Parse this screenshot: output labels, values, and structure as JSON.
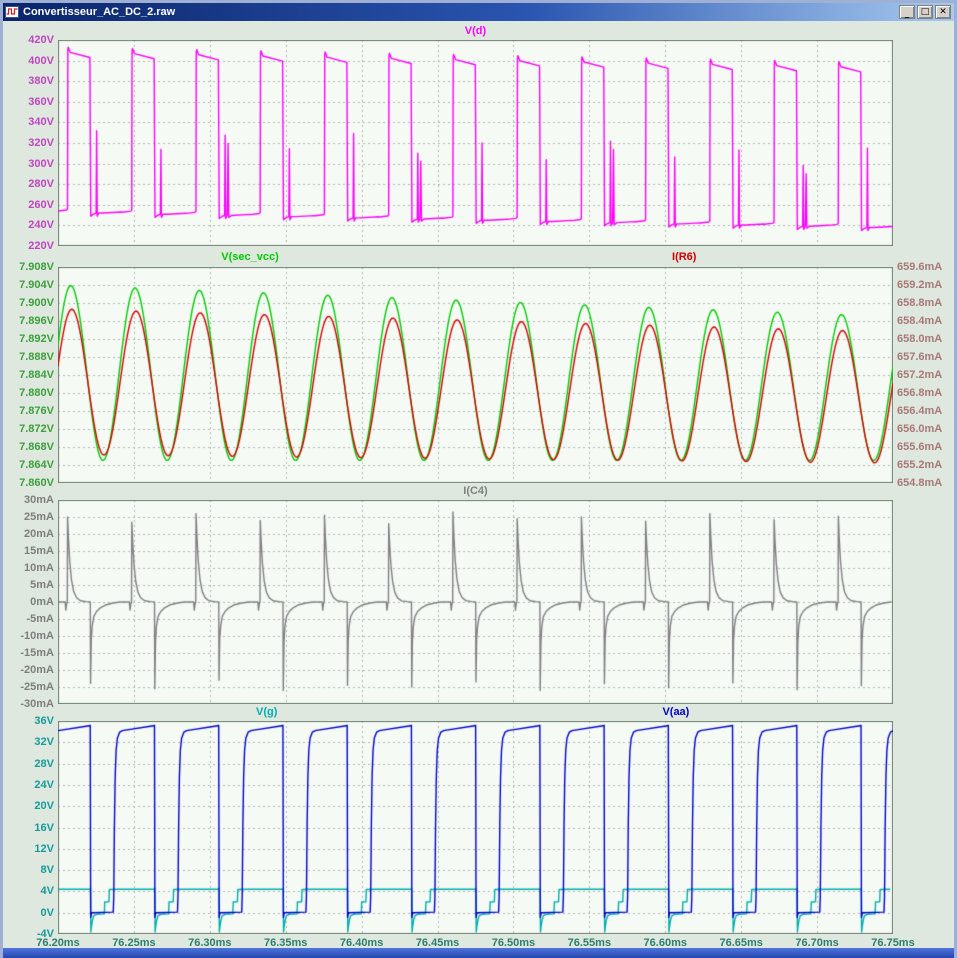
{
  "window": {
    "title": "Convertisseur_AC_DC_2.raw",
    "controls": {
      "minimize": "_",
      "maximize": "□",
      "close": "✕"
    }
  },
  "time_axis": {
    "unit": "ms",
    "start_ms": 76.2,
    "end_ms": 76.75,
    "tick_step_ms": 0.05,
    "tick_labels": [
      "76.20ms",
      "76.25ms",
      "76.30ms",
      "76.35ms",
      "76.40ms",
      "76.45ms",
      "76.50ms",
      "76.55ms",
      "76.60ms",
      "76.65ms",
      "76.70ms",
      "76.75ms"
    ],
    "label_color": "#2E7D6E"
  },
  "chart_data": [
    {
      "type": "line",
      "id": "vd",
      "traces": [
        {
          "name": "V(d)",
          "color": "#FF00FF",
          "axis": "left",
          "title_x_frac": 0.5,
          "waveform": {
            "kind": "switch_node",
            "cycles": 13,
            "high": 408,
            "low": 252,
            "drift": -14,
            "spikes": [
              332,
              315,
              330,
              318,
              334,
              316,
              327,
              312,
              331,
              317,
              325,
              311,
              329
            ]
          }
        }
      ],
      "y_axis_left": {
        "unit": "V",
        "min": 220,
        "max": 420,
        "step": 20,
        "color": "#BE46BE",
        "tick_labels": [
          "420V",
          "400V",
          "380V",
          "360V",
          "340V",
          "320V",
          "300V",
          "280V",
          "260V",
          "240V",
          "220V"
        ]
      }
    },
    {
      "type": "line",
      "id": "sec-vcc-ir6",
      "traces": [
        {
          "name": "V(sec_vcc)",
          "color": "#00CC00",
          "axis": "left",
          "title_x_frac": 0.23,
          "waveform": {
            "kind": "ripple",
            "cycles": 13,
            "mid": 7.8845,
            "amp": 0.0195,
            "mid_drift": -0.0035,
            "amp_decay": 0.18,
            "peak_frac": 0.2
          }
        },
        {
          "name": "I(R6)",
          "color": "#D40000",
          "axis": "right",
          "title_x_frac": 0.75,
          "waveform": {
            "kind": "ripple",
            "cycles": 13,
            "mid": 657.05,
            "amp": 1.62,
            "mid_drift": -0.35,
            "amp_decay": 0.1,
            "peak_frac": 0.215
          }
        }
      ],
      "y_axis_left": {
        "unit": "V",
        "min": 7.86,
        "max": 7.908,
        "step": 0.004,
        "color": "#3C9E3C",
        "tick_labels": [
          "7.908V",
          "7.904V",
          "7.900V",
          "7.896V",
          "7.892V",
          "7.888V",
          "7.884V",
          "7.880V",
          "7.876V",
          "7.872V",
          "7.868V",
          "7.864V",
          "7.860V"
        ]
      },
      "y_axis_right": {
        "unit": "mA",
        "min": 654.8,
        "max": 659.6,
        "step": 0.4,
        "color": "#A87878",
        "tick_labels": [
          "659.6mA",
          "659.2mA",
          "658.8mA",
          "658.4mA",
          "658.0mA",
          "657.6mA",
          "657.2mA",
          "656.8mA",
          "656.4mA",
          "656.0mA",
          "655.6mA",
          "655.2mA",
          "654.8mA"
        ]
      }
    },
    {
      "type": "line",
      "id": "ic4",
      "traces": [
        {
          "name": "I(C4)",
          "color": "#808080",
          "axis": "left",
          "title_x_frac": 0.5,
          "waveform": {
            "kind": "cap_current",
            "cycles": 13,
            "pos": [
              25,
              23.5,
              26,
              24,
              25.5,
              23,
              26.5,
              24.5,
              25,
              23.8,
              26,
              24.2,
              25.2
            ],
            "neg": [
              24,
              25.5,
              23,
              26,
              24.5,
              25,
              23.5,
              26,
              24,
              25.2,
              23.8,
              25.8,
              24.6
            ]
          }
        }
      ],
      "y_axis_left": {
        "unit": "mA",
        "min": -30,
        "max": 30,
        "step": 5,
        "color": "#7E7E7E",
        "tick_labels": [
          "30mA",
          "25mA",
          "20mA",
          "15mA",
          "10mA",
          "5mA",
          "0mA",
          "-5mA",
          "-10mA",
          "-15mA",
          "-20mA",
          "-25mA",
          "-30mA"
        ]
      }
    },
    {
      "type": "line",
      "id": "vg-vaa",
      "traces": [
        {
          "name": "V(g)",
          "color": "#00AEAE",
          "axis": "left",
          "title_x_frac": 0.25,
          "waveform": {
            "kind": "gate_drive",
            "cycles": 13,
            "high": 4.4,
            "dip": -3.6
          }
        },
        {
          "name": "V(aa)",
          "color": "#0000CC",
          "axis": "left",
          "title_x_frac": 0.74,
          "waveform": {
            "kind": "aux_square",
            "cycles": 13,
            "high": 35,
            "low": 0
          }
        }
      ],
      "y_axis_left": {
        "unit": "V",
        "min": -4,
        "max": 36,
        "step": 4,
        "color": "#169A9A",
        "tick_labels": [
          "36V",
          "32V",
          "28V",
          "24V",
          "20V",
          "16V",
          "12V",
          "8V",
          "4V",
          "0V",
          "-4V"
        ]
      }
    }
  ]
}
